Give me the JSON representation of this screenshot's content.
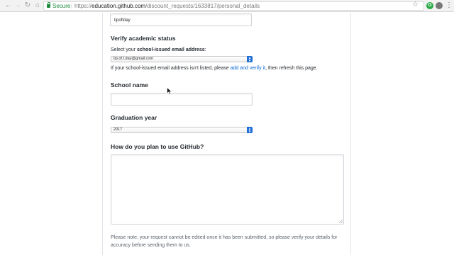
{
  "browser": {
    "secure_label": "Secure",
    "url_scheme": "https://",
    "url_host": "education.github.com",
    "url_path": "/discount_requests/1633817/personal_details",
    "extension_label": "G"
  },
  "form": {
    "school_tag_value": "tipoftday",
    "verify": {
      "heading": "Verify academic status",
      "prompt_prefix": "Select your ",
      "prompt_bold": "school-issued email address",
      "prompt_suffix": ":",
      "email_selected": "tip.of.t.day@gmail.com",
      "help_prefix": "If your school-issued email address isn't listed, please ",
      "help_link": "add and verify it",
      "help_suffix": ", then refresh this page."
    },
    "school": {
      "heading": "School name",
      "value": ""
    },
    "graduation": {
      "heading": "Graduation year",
      "selected": "2017"
    },
    "usage": {
      "heading": "How do you plan to use GitHub?",
      "value": ""
    },
    "note_line1": "Please note, your request cannot be edited once it has been submitted, so please verify your details for",
    "note_line2": "accuracy before sending them to us."
  }
}
